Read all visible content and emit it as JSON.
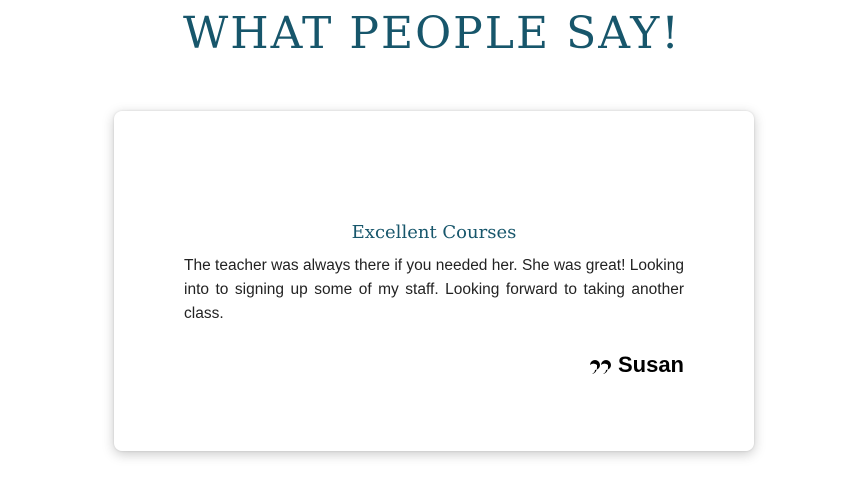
{
  "section": {
    "title": "WHAT PEOPLE SAY!"
  },
  "testimonial": {
    "heading": "Excellent Courses",
    "body": "The teacher was always there if you needed her. She was great! Looking into to signing up some of my staff. Looking forward to taking another class.",
    "author": "Susan",
    "author_icon": "quote-left-icon"
  },
  "colors": {
    "accent": "#17566b",
    "text": "#222222",
    "author": "#000000"
  }
}
